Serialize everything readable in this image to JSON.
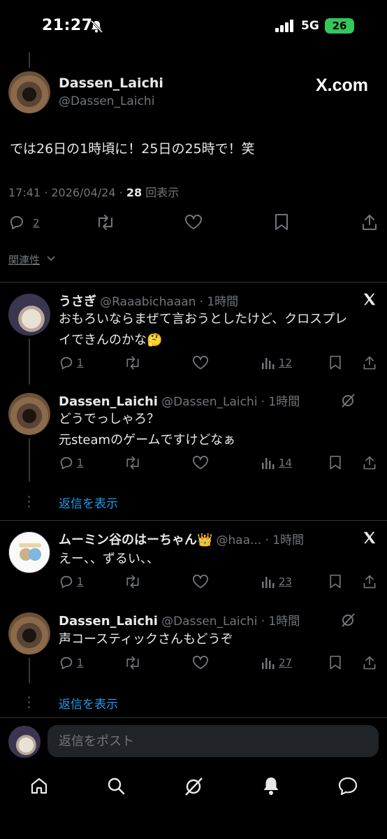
{
  "status_bar": {
    "time": "21:27",
    "network": "5G",
    "battery": "26"
  },
  "main_tweet": {
    "display_name": "Dassen_Laichi",
    "handle": "@Dassen_Laichi",
    "watermark": "X.com",
    "text": "では26日の1時頃に！25日の25時で！笑",
    "timestamp": "17:41 · 2026/04/24 · ",
    "views_count": "28",
    "views_label": " 回表示",
    "reply_count": "2"
  },
  "sort_label": "関連性",
  "replies": [
    {
      "display_name": "うさぎ",
      "handle": "@Raaabichaaan",
      "time": "· 1時間",
      "text_lines": [
        "おもろいならまぜて言おうとしたけど、クロスプレ",
        "イできんのかな🤔"
      ],
      "reply_count": "1",
      "views": "12"
    },
    {
      "display_name": "Dassen_Laichi",
      "handle": "@Dassen_Laichi",
      "time": "· 1時間",
      "text_lines": [
        "どうでっしゃろ？",
        "元steamのゲームですけどなぁ"
      ],
      "reply_count": "1",
      "views": "14"
    },
    {
      "display_name": "ムーミン谷のはーちゃん👑",
      "handle": "@haa...",
      "time": "· 1時間",
      "text_lines": [
        "えー、、ずるい、、"
      ],
      "reply_count": "1",
      "views": "23"
    },
    {
      "display_name": "Dassen_Laichi",
      "handle": "@Dassen_Laichi",
      "time": "· 1時間",
      "text_lines": [
        "声コースティックさんもどうぞ"
      ],
      "reply_count": "1",
      "views": "27"
    }
  ],
  "show_replies_label": "返信を表示",
  "reply_input": {
    "placeholder": "返信をポスト"
  },
  "colors": {
    "background": "#000000",
    "text": "#e7e9ea",
    "muted": "#71767b",
    "accent": "#1d9bf0",
    "battery": "#34c759"
  },
  "icons": [
    "bell-slash-icon",
    "signal-icon",
    "battery-icon",
    "x-logo-icon",
    "reply-icon",
    "repost-icon",
    "like-icon",
    "bookmark-icon",
    "share-icon",
    "views-icon",
    "grok-icon",
    "home-icon",
    "search-icon",
    "notifications-icon",
    "messages-icon",
    "chevron-down-icon"
  ]
}
